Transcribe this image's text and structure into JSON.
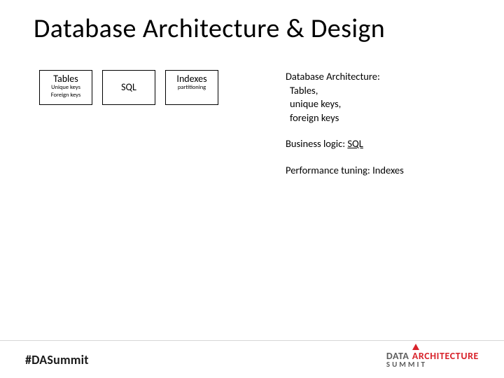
{
  "title": "Database Architecture & Design",
  "boxes": {
    "tables": {
      "label": "Tables",
      "sub1": "Unique keys",
      "sub2": "Foreign keys"
    },
    "sql": {
      "label": "SQL"
    },
    "indexes": {
      "label": "Indexes",
      "sub1": "partitioning"
    }
  },
  "bullets": {
    "arch": {
      "heading": "Database Architecture:",
      "lines": [
        "Tables,",
        "unique keys,",
        "foreign keys"
      ]
    },
    "logic": {
      "label": "Business logic:",
      "value": "SQL"
    },
    "perf": {
      "label": "Performance tuning:",
      "value": "Indexes"
    }
  },
  "footer": {
    "hashtag": "#DASummit",
    "logo_word1": "DATA",
    "logo_word2": "ARCHITECTURE",
    "logo_word3": "SUMMIT"
  },
  "colors": {
    "accent": "#d8222a"
  }
}
